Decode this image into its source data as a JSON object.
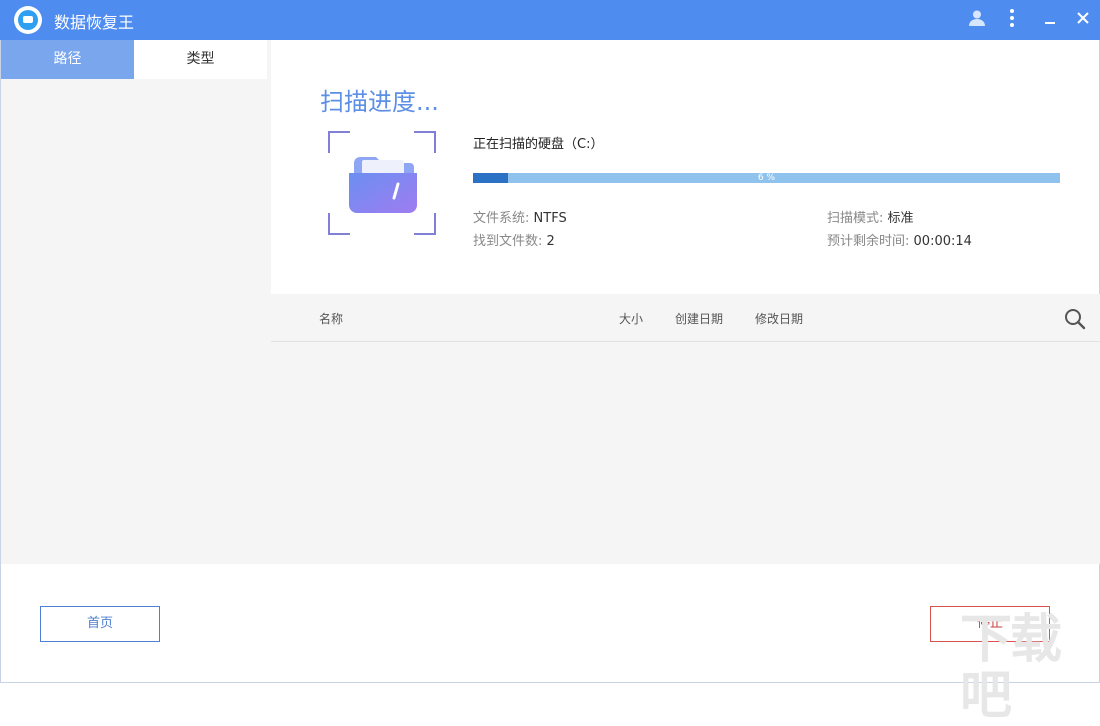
{
  "window": {
    "title": "数据恢复王"
  },
  "sidebar": {
    "tabs": [
      {
        "label": "路径",
        "active": true
      },
      {
        "label": "类型",
        "active": false
      }
    ]
  },
  "scan": {
    "heading": "扫描进度...",
    "scanning_label": "正在扫描的硬盘（C:）",
    "progress_percent": 6,
    "progress_text": "6 %",
    "filesystem_label": "文件系统:",
    "filesystem_value": "NTFS",
    "files_found_label": "找到文件数:",
    "files_found_value": "2",
    "scan_mode_label": "扫描模式:",
    "scan_mode_value": "标准",
    "time_left_label": "预计剩余时间:",
    "time_left_value": "00:00:14"
  },
  "table": {
    "columns": {
      "name": "名称",
      "size": "大小",
      "created": "创建日期",
      "modified": "修改日期"
    },
    "rows": []
  },
  "footer": {
    "home_label": "首页",
    "stop_label": "停止"
  },
  "icons": {
    "app": "data-recovery-logo-icon",
    "user": "user-icon",
    "more": "more-vertical-icon",
    "minimize": "minimize-icon",
    "close": "close-icon",
    "folder": "folder-icon",
    "search": "search-icon"
  },
  "colors": {
    "titlebar": "#4f8cf0",
    "accent": "#5d8fe6",
    "progress_fill": "#2b72c4",
    "progress_track": "#8fc3ee",
    "stop": "#d9534f"
  },
  "watermark": "下载吧"
}
